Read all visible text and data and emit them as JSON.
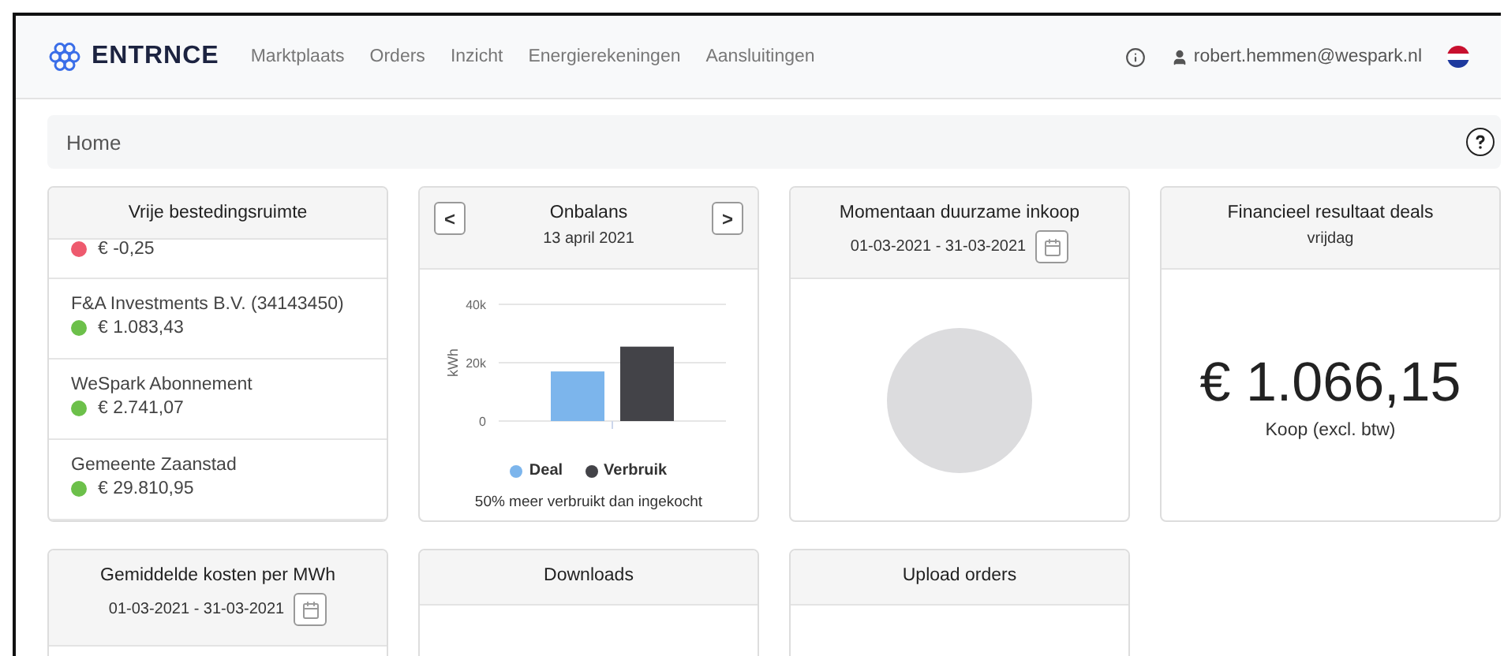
{
  "nav": {
    "brand": "ENTRNCE",
    "links": [
      "Marktplaats",
      "Orders",
      "Inzicht",
      "Energierekeningen",
      "Aansluitingen"
    ],
    "user": "robert.hemmen@wespark.nl"
  },
  "breadcrumb": "Home",
  "budget": {
    "title": "Vrije bestedingsruimte",
    "items": [
      {
        "amount": "€ -0,25",
        "color": "#ee5a6e"
      },
      {
        "name": "F&A Investments B.V. (34143450)",
        "amount": "€ 1.083,43",
        "color": "#6cc04a"
      },
      {
        "name": "WeSpark Abonnement",
        "amount": "€ 2.741,07",
        "color": "#6cc04a"
      },
      {
        "name": "Gemeente Zaanstad",
        "amount": "€ 29.810,95",
        "color": "#6cc04a"
      }
    ]
  },
  "imbalance": {
    "title": "Onbalans",
    "date": "13 april 2021",
    "prev": "<",
    "next": ">",
    "note": "50% meer verbruikt dan ingekocht",
    "chart_data": {
      "type": "bar",
      "ylabel": "kWh",
      "categories": [
        null
      ],
      "ylim": [
        0,
        40000
      ],
      "yticks": [
        {
          "value": 0,
          "label": "0"
        },
        {
          "value": 20000,
          "label": "20k"
        },
        {
          "value": 40000,
          "label": "40k"
        }
      ],
      "series": [
        {
          "name": "Deal",
          "color": "#7cb5ec",
          "values": [
            17000
          ]
        },
        {
          "name": "Verbruik",
          "color": "#434348",
          "values": [
            25500
          ]
        }
      ]
    }
  },
  "sustainable": {
    "title": "Momentaan duurzame inkoop",
    "period": "01-03-2021 - 31-03-2021"
  },
  "result": {
    "title": "Financieel resultaat deals",
    "subtitle": "vrijdag",
    "amount": "€ 1.066,15",
    "caption": "Koop (excl. btw)"
  },
  "avgcost": {
    "title": "Gemiddelde kosten per MWh",
    "period": "01-03-2021 - 31-03-2021"
  },
  "downloads": {
    "title": "Downloads"
  },
  "upload": {
    "title": "Upload orders"
  }
}
